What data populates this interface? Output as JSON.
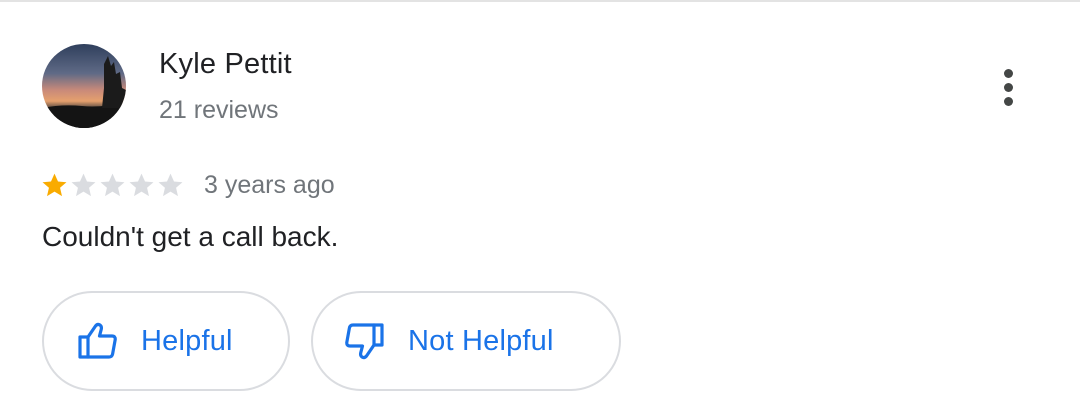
{
  "review": {
    "reviewer_name": "Kyle Pettit",
    "review_count": "21 reviews",
    "rating": 1,
    "max_rating": 5,
    "age": "3 years ago",
    "text": "Couldn't get a call back."
  },
  "actions": {
    "helpful_label": "Helpful",
    "not_helpful_label": "Not Helpful"
  },
  "icons": {
    "avatar": "profile-photo-sunset",
    "more": "more-vert-icon",
    "helpful": "thumb-up-icon",
    "not_helpful": "thumb-down-icon",
    "star": "star-icon"
  },
  "colors": {
    "star_filled": "#f9ab00",
    "star_empty": "#dadce0",
    "accent": "#1a73e8",
    "text_primary": "#202124",
    "text_secondary": "#70757a"
  }
}
